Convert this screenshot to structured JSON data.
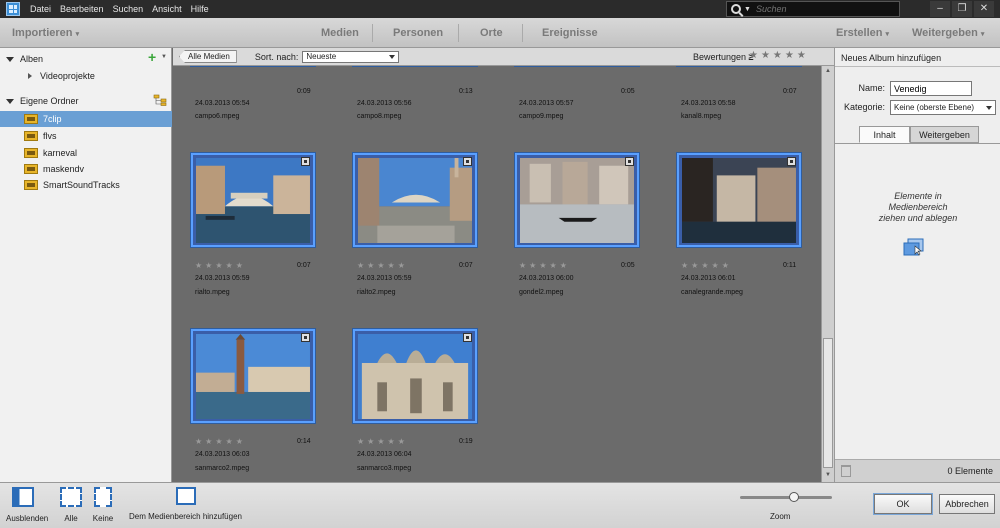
{
  "menu": {
    "items": [
      "Datei",
      "Bearbeiten",
      "Suchen",
      "Ansicht",
      "Hilfe"
    ],
    "search_placeholder": "Suchen"
  },
  "toolbar": {
    "import_label": "Importieren",
    "tabs": [
      "Medien",
      "Personen",
      "Orte",
      "Ereignisse"
    ],
    "create_label": "Erstellen",
    "share_label": "Weitergeben"
  },
  "left_panel": {
    "albums_label": "Alben",
    "album_items": [
      "Videoprojekte"
    ],
    "folders_label": "Eigene Ordner",
    "folders": [
      "7clip",
      "flvs",
      "karneval",
      "maskendv",
      "SmartSoundTracks"
    ],
    "selected_folder": "7clip"
  },
  "pathbar": {
    "all_media_label": "Alle Medien",
    "sort_label": "Sort. nach:",
    "sort_value": "Neueste",
    "ratings_label": "Bewertungen",
    "ratings_op": "≥",
    "ratings_stars": "★★★★★"
  },
  "media": {
    "top_row": [
      {
        "duration": "0:09",
        "date": "24.03.2013 05:54",
        "name": "campo6.mpeg"
      },
      {
        "duration": "0:13",
        "date": "24.03.2013 05:56",
        "name": "campo8.mpeg"
      },
      {
        "duration": "0:05",
        "date": "24.03.2013 05:57",
        "name": "campo9.mpeg"
      },
      {
        "duration": "0:07",
        "date": "24.03.2013 05:58",
        "name": "kanal8.mpeg"
      }
    ],
    "items": [
      {
        "duration": "0:07",
        "date": "24.03.2013 05:59",
        "name": "rialto.mpeg",
        "stars": "★★★★★"
      },
      {
        "duration": "0:07",
        "date": "24.03.2013 05:59",
        "name": "rialto2.mpeg",
        "stars": "★★★★★"
      },
      {
        "duration": "0:05",
        "date": "24.03.2013 06:00",
        "name": "gondel2.mpeg",
        "stars": "★★★★★"
      },
      {
        "duration": "0:11",
        "date": "24.03.2013 06:01",
        "name": "canalegrande.mpeg",
        "stars": "★★★★★"
      },
      {
        "duration": "0:14",
        "date": "24.03.2013 06:03",
        "name": "sanmarco2.mpeg",
        "stars": "★★★★★"
      },
      {
        "duration": "0:19",
        "date": "24.03.2013 06:04",
        "name": "sanmarco3.mpeg",
        "stars": "★★★★★"
      }
    ]
  },
  "right_panel": {
    "title": "Neues Album hinzufügen",
    "name_label": "Name:",
    "name_value": "Venedig",
    "category_label": "Kategorie:",
    "category_value": "Keine (oberste Ebene)",
    "tab_content": "Inhalt",
    "tab_share": "Weitergeben",
    "drop_hint_1": "Elemente in",
    "drop_hint_2": "Medienbereich",
    "drop_hint_3": "ziehen und ablegen",
    "elements_count": "0 Elemente"
  },
  "bottombar": {
    "hide_label": "Ausblenden",
    "all_label": "Alle",
    "none_label": "Keine",
    "add_label": "Dem Medienbereich hinzufügen",
    "zoom_label": "Zoom",
    "zoom_level": 0.6,
    "ok_label": "OK",
    "cancel_label": "Abbrechen"
  },
  "colors": {
    "selection": "#6a9fd4",
    "thumb_border": "#5aa0ff",
    "accent_blue": "#2b6cb8"
  }
}
